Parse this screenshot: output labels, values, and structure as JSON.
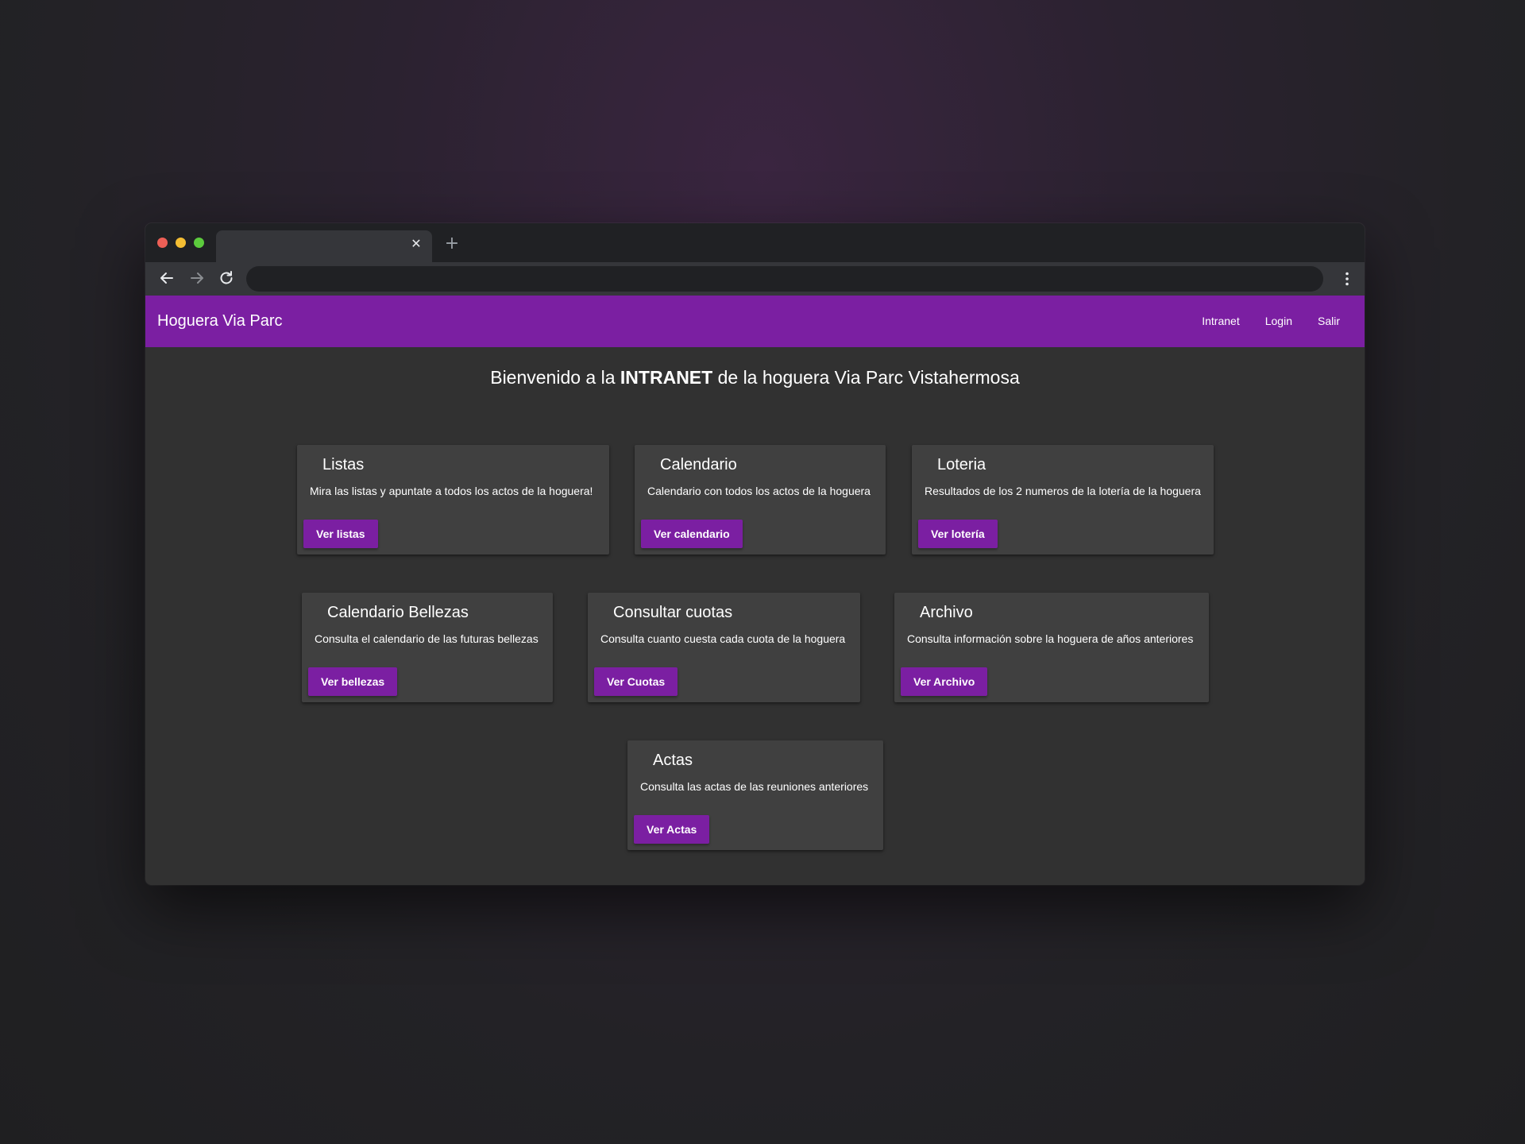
{
  "browser": {
    "tab_close_glyph": "✕",
    "new_tab_glyph": "+",
    "icons": [
      "back-arrow-icon",
      "forward-arrow-icon",
      "reload-icon",
      "kebab-menu-icon"
    ]
  },
  "navbar": {
    "brand": "Hoguera Via Parc",
    "links": [
      "Intranet",
      "Login",
      "Salir"
    ],
    "color": "#7b1fa2"
  },
  "welcome": {
    "prefix": "Bienvenido a la ",
    "bold": "INTRANET",
    "suffix": " de la hoguera Via Parc Vistahermosa"
  },
  "cards": [
    {
      "title": "Listas",
      "text": "Mira las listas y apuntate a todos los actos de la hoguera!",
      "button": "Ver listas"
    },
    {
      "title": "Calendario",
      "text": "Calendario con todos los actos de la hoguera",
      "button": "Ver calendario"
    },
    {
      "title": "Loteria",
      "text": "Resultados de los 2 numeros de la lotería de la hoguera",
      "button": "Ver lotería"
    },
    {
      "title": "Calendario Bellezas",
      "text": "Consulta el calendario de las futuras bellezas",
      "button": "Ver bellezas"
    },
    {
      "title": "Consultar cuotas",
      "text": "Consulta cuanto cuesta cada cuota de la hoguera",
      "button": "Ver Cuotas"
    },
    {
      "title": "Archivo",
      "text": "Consulta información sobre la hoguera de años anteriores",
      "button": "Ver Archivo"
    },
    {
      "title": "Actas",
      "text": "Consulta las actas de las reuniones anteriores",
      "button": "Ver Actas"
    }
  ],
  "colors": {
    "background": "#313131",
    "card": "#404040",
    "accent": "#7b1fa2"
  }
}
